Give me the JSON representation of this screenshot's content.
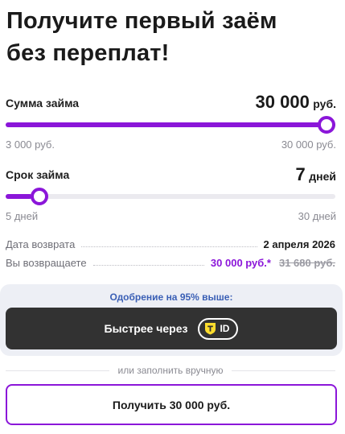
{
  "title": {
    "line1": "Получите первый заём",
    "line2": "без переплат!"
  },
  "loan_amount": {
    "label": "Сумма займа",
    "value": "30 000",
    "unit": "руб.",
    "min_label": "3 000 руб.",
    "max_label": "30 000 руб.",
    "slider_fraction": 1.0
  },
  "loan_term": {
    "label": "Срок займа",
    "value": "7",
    "unit": "дней",
    "min_label": "5 дней",
    "max_label": "30 дней",
    "slider_fraction": 0.08
  },
  "return_date": {
    "label": "Дата возврата",
    "value": "2 апреля 2026"
  },
  "repay": {
    "label": "Вы возвращаете",
    "value": "30 000 руб.*",
    "old_value": "31 680 руб."
  },
  "promo": {
    "text": "Одобрение на 95% выше:",
    "button_label": "Быстрее через",
    "badge_text": "ID",
    "badge_icon": "t-shield-icon"
  },
  "divider_text": "или заполнить вручную",
  "submit_label": "Получить 30 000 руб.",
  "colors": {
    "accent": "#8b16d9",
    "promo_text": "#3a5fb5",
    "dark_button": "#323232",
    "badge_yellow": "#ffdd2d"
  }
}
